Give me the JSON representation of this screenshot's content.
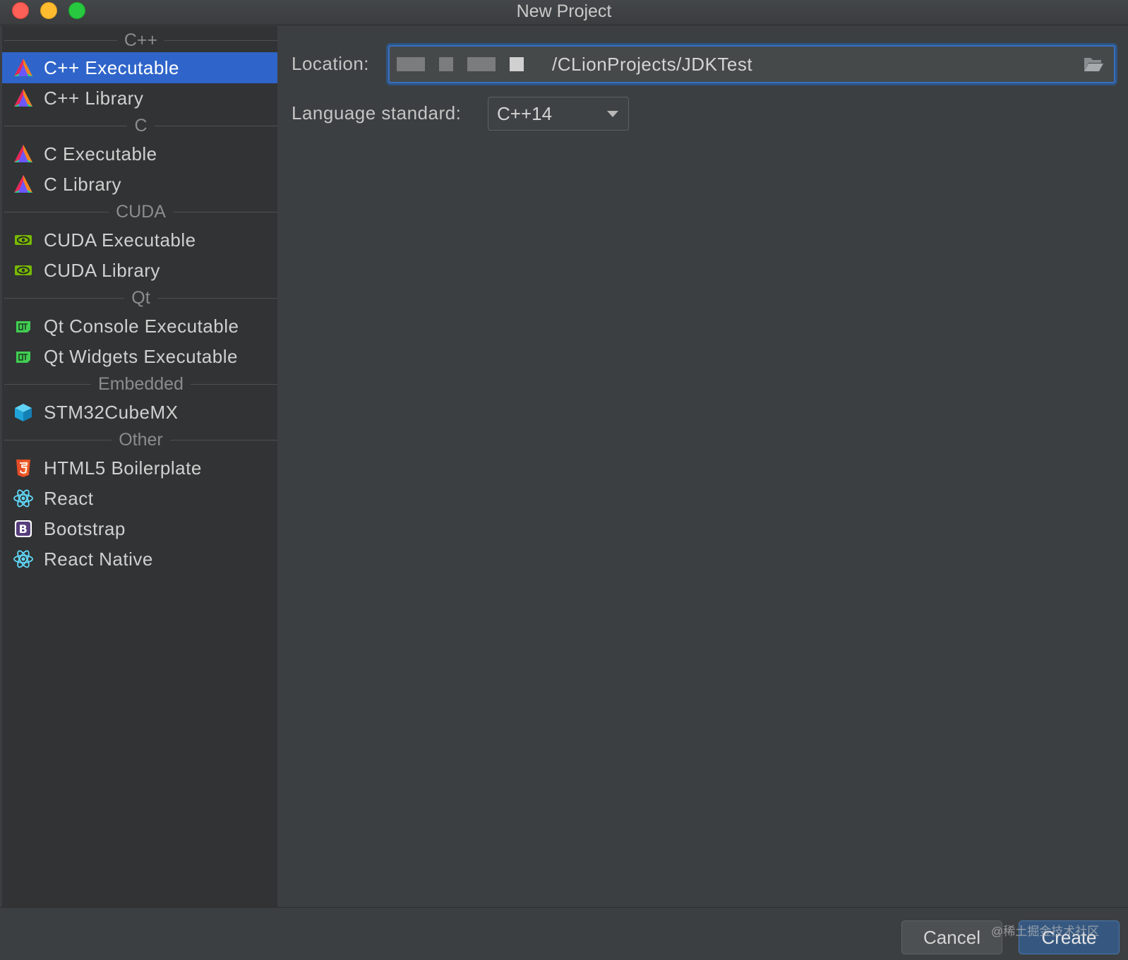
{
  "window": {
    "title": "New Project"
  },
  "sidebar": {
    "sections": [
      {
        "label": "C++",
        "items": [
          {
            "label": "C++ Executable",
            "icon": "clion-icon",
            "selected": true
          },
          {
            "label": "C++ Library",
            "icon": "clion-icon"
          }
        ]
      },
      {
        "label": "C",
        "items": [
          {
            "label": "C Executable",
            "icon": "clion-icon"
          },
          {
            "label": "C Library",
            "icon": "clion-icon"
          }
        ]
      },
      {
        "label": "CUDA",
        "items": [
          {
            "label": "CUDA Executable",
            "icon": "nvidia-icon"
          },
          {
            "label": "CUDA Library",
            "icon": "nvidia-icon"
          }
        ]
      },
      {
        "label": "Qt",
        "items": [
          {
            "label": "Qt Console Executable",
            "icon": "qt-icon"
          },
          {
            "label": "Qt Widgets Executable",
            "icon": "qt-icon"
          }
        ]
      },
      {
        "label": "Embedded",
        "items": [
          {
            "label": "STM32CubeMX",
            "icon": "cube-icon"
          }
        ]
      },
      {
        "label": "Other",
        "items": [
          {
            "label": "HTML5 Boilerplate",
            "icon": "html5-icon"
          },
          {
            "label": "React",
            "icon": "react-icon"
          },
          {
            "label": "Bootstrap",
            "icon": "bootstrap-icon"
          },
          {
            "label": "React Native",
            "icon": "react-icon"
          }
        ]
      }
    ]
  },
  "form": {
    "location_label": "Location:",
    "location_value": "/CLionProjects/JDKTest",
    "language_label": "Language standard:",
    "language_value": "C++14"
  },
  "buttons": {
    "cancel": "Cancel",
    "create": "Create"
  },
  "watermark": "@稀土掘金技术社区",
  "colors": {
    "selection": "#2f65ca",
    "focus": "#3a6ec0",
    "background": "#3c3f41",
    "sidebar": "#323334"
  }
}
